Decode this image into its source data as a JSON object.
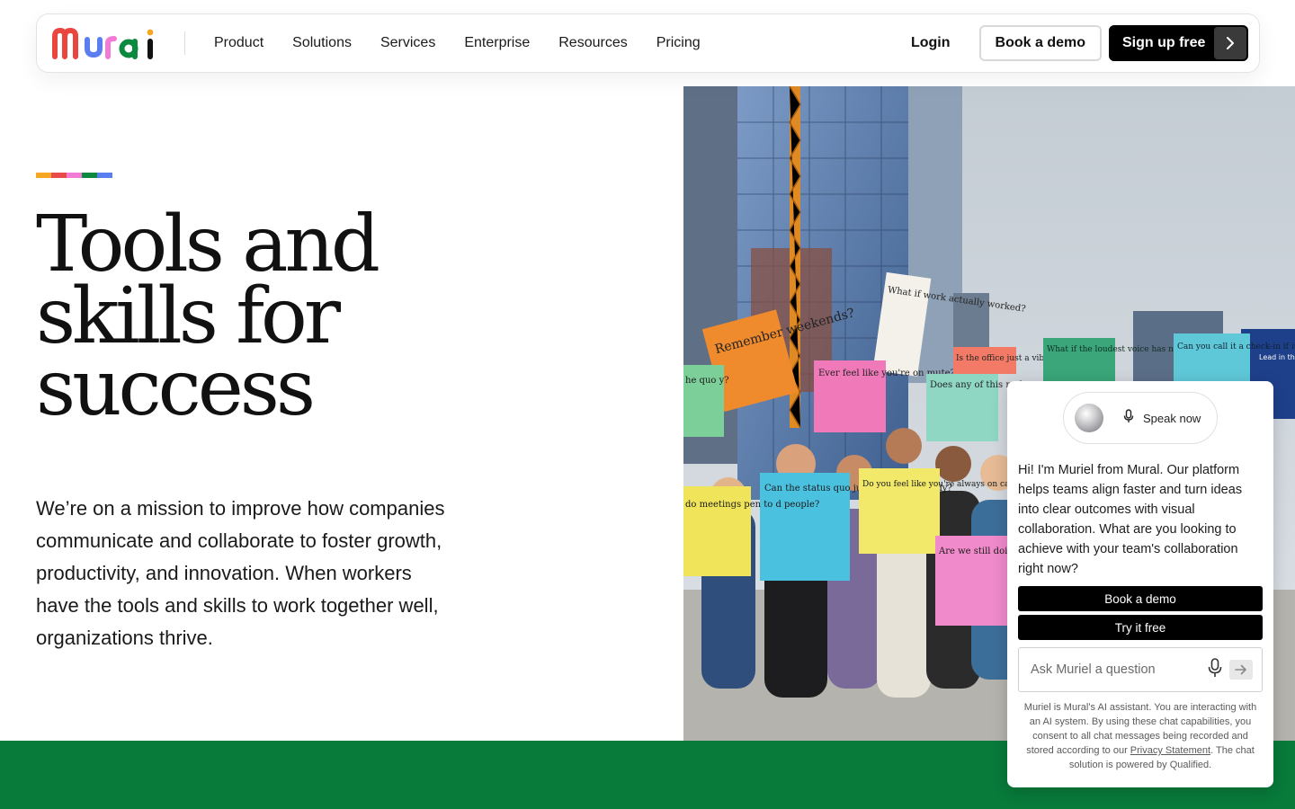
{
  "nav": {
    "logo_text": "Mural",
    "links": [
      "Product",
      "Solutions",
      "Services",
      "Enterprise",
      "Resources",
      "Pricing"
    ],
    "login": "Login",
    "book_demo": "Book a demo",
    "signup": "Sign up free"
  },
  "brand_colors": [
    "#f5a623",
    "#e94b4b",
    "#f27bd6",
    "#0b8a3f",
    "#5a7ef0"
  ],
  "hero": {
    "title_lines": [
      "Tools and",
      "skills for",
      "success"
    ],
    "description": "We’re on a mission to improve how companies communicate and collaborate to foster growth, productivity, and innovation. When workers have the tools and skills to work together well, organizations thrive."
  },
  "chat": {
    "speak_now": "Speak now",
    "message": "Hi! I'm Muriel from Mural. Our platform helps teams align faster and turn ideas into clear outcomes with visual collaboration. What are you looking to achieve with your team's collaboration right now?",
    "book_demo": "Book a demo",
    "try_free": "Try it free",
    "ask_placeholder": "Ask Muriel a question",
    "disclaimer_before": "Muriel is Mural’s AI assistant. You are interacting with an AI system. By using these chat capabilities, you consent to all chat messages being recorded and stored according to our ",
    "privacy_link": "Privacy Statement",
    "disclaimer_after": ". The chat solution is powered by Qualified."
  },
  "signs": [
    {
      "text": "Remember weekends?"
    },
    {
      "text": "What if work actually worked?"
    },
    {
      "text": "Ever feel like you're on mute?"
    },
    {
      "text": "Does any of this make sense?"
    },
    {
      "text": "Is the office just a vibe?"
    },
    {
      "text": "What if the loudest voice has nothing"
    },
    {
      "text": "Can you call it a check-in if it lasts"
    },
    {
      "text": "Lead in the"
    },
    {
      "text": "Can the status quo just go away already?"
    },
    {
      "text": "Do you feel like you're always on call(s)?"
    },
    {
      "text": "Are we still doing this"
    },
    {
      "text": "do meetings pen to d people?"
    },
    {
      "text": "he quo y?"
    }
  ]
}
